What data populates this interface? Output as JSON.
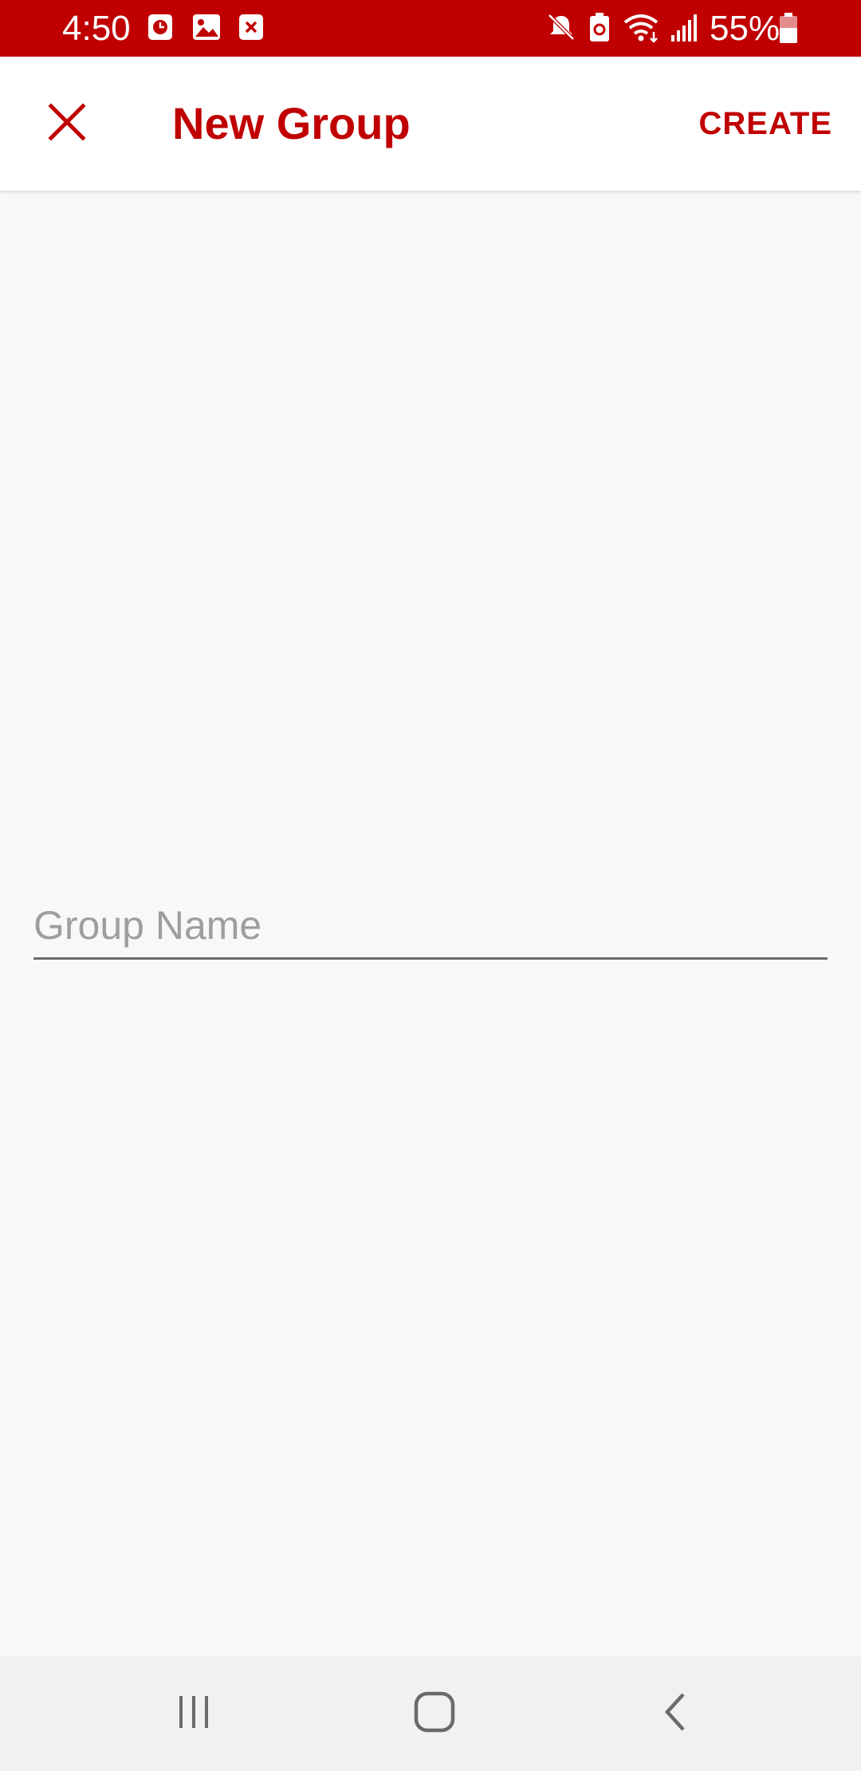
{
  "status_bar": {
    "time": "4:50",
    "battery_percent": "55%",
    "left_icons": [
      "clock-notification-icon",
      "image-notification-icon",
      "close-notification-icon"
    ],
    "right_icons": [
      "mute-icon",
      "battery-saver-icon",
      "wifi-icon",
      "signal-icon",
      "battery-icon"
    ]
  },
  "header": {
    "title": "New Group",
    "close_icon": "close-icon",
    "create_label": "CREATE"
  },
  "form": {
    "group_name_placeholder": "Group Name",
    "group_name_value": ""
  },
  "nav_bar": {
    "icons": [
      "recent-apps-icon",
      "home-icon",
      "back-icon"
    ]
  },
  "colors": {
    "accent": "#c00000",
    "status_bar": "#c00000",
    "background": "#f8f8f8",
    "app_bar": "#ffffff",
    "nav_bar": "#f1f1f1"
  }
}
